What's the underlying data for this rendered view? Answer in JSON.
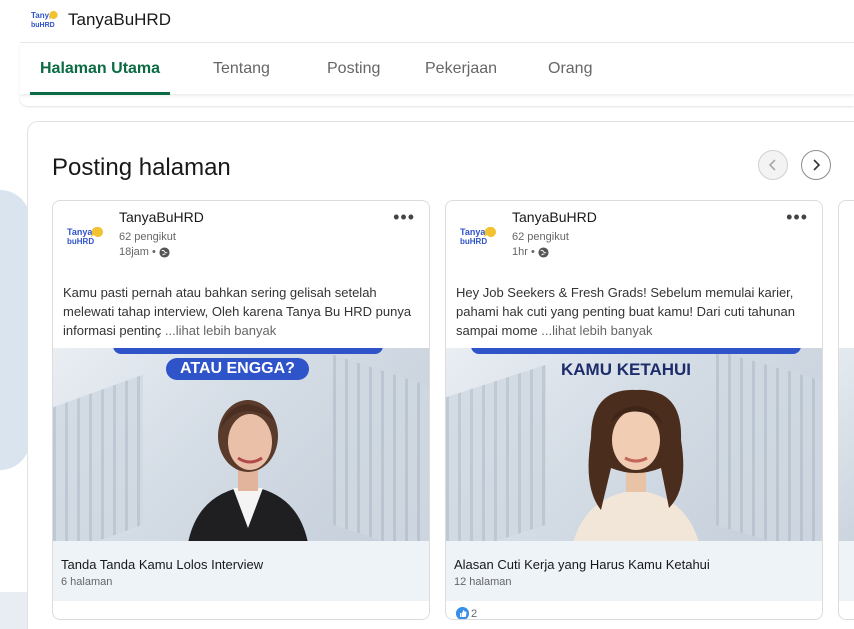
{
  "header": {
    "company_name": "TanyaBuHRD",
    "logo_text": "Tanya buHRD"
  },
  "tabs": [
    {
      "label": "Halaman Utama",
      "active": true
    },
    {
      "label": "Tentang"
    },
    {
      "label": "Posting"
    },
    {
      "label": "Pekerjaan"
    },
    {
      "label": "Orang"
    }
  ],
  "section": {
    "title": "Posting halaman"
  },
  "posts": [
    {
      "author": "TanyaBuHRD",
      "followers": "62 pengikut",
      "time": "18jam •",
      "text": "Kamu pasti pernah atau bahkan sering gelisah setelah melewati tahap interview, Oleh karena Tanya Bu HRD punya informasi pentinç",
      "see_more": "...lihat lebih banyak",
      "image_headline": "ATAU ENGGA?",
      "caption_title": "Tanda Tanda Kamu Lolos Interview",
      "caption_sub": "6 halaman"
    },
    {
      "author": "TanyaBuHRD",
      "followers": "62 pengikut",
      "time": "1hr •",
      "text": "Hey Job Seekers & Fresh Grads! Sebelum memulai karier, pahami hak cuti yang penting buat kamu! Dari cuti tahunan sampai mome",
      "see_more": "...lihat lebih banyak",
      "image_headline": "KAMU KETAHUI",
      "caption_title": "Alasan Cuti Kerja yang Harus Kamu Ketahui",
      "caption_sub": "12 halaman",
      "reactions": "2"
    }
  ],
  "colors": {
    "accent": "#0b6b44",
    "headline_blue": "#2f53c9",
    "caption_bg": "#eef3f8"
  }
}
